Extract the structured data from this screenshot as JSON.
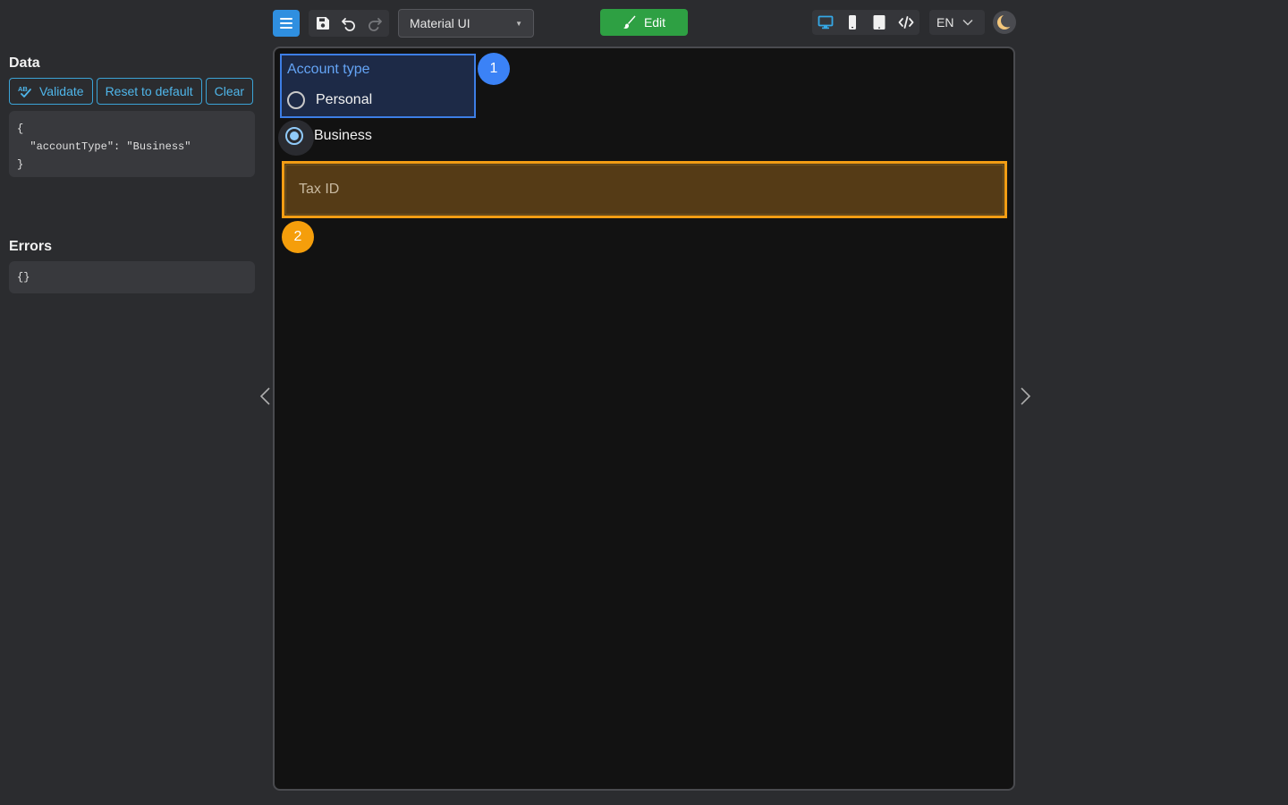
{
  "toolbar": {
    "theme_selected": "Material UI",
    "edit_label": "Edit",
    "language": "EN"
  },
  "data_panel": {
    "title": "Data",
    "buttons": {
      "validate": "Validate",
      "reset": "Reset to default",
      "clear": "Clear"
    },
    "json_text": "{\n  \"accountType\": \"Business\"\n}"
  },
  "errors_panel": {
    "title": "Errors",
    "json_text": "{}"
  },
  "form": {
    "account_type": {
      "label": "Account type",
      "options": [
        "Personal",
        "Business"
      ],
      "selected": "Business"
    },
    "tax_id": {
      "label": "Tax ID",
      "value": ""
    },
    "badges": [
      "1",
      "2"
    ]
  },
  "colors": {
    "accent_blue": "#2f8fe0",
    "edit_green": "#2ea043",
    "highlight_blue": "#3d7ee5",
    "highlight_orange": "#f29d14",
    "link_blue": "#4fb6ea"
  },
  "icons": {
    "menu": "hamburger-menu-icon",
    "save": "save-icon",
    "undo": "undo-icon",
    "redo": "redo-icon",
    "edit": "paintbrush-icon",
    "desktop": "desktop-icon",
    "mobile": "mobile-icon",
    "tablet": "tablet-icon",
    "code": "code-icon",
    "theme": "moon-icon",
    "validate": "spellcheck-icon"
  }
}
